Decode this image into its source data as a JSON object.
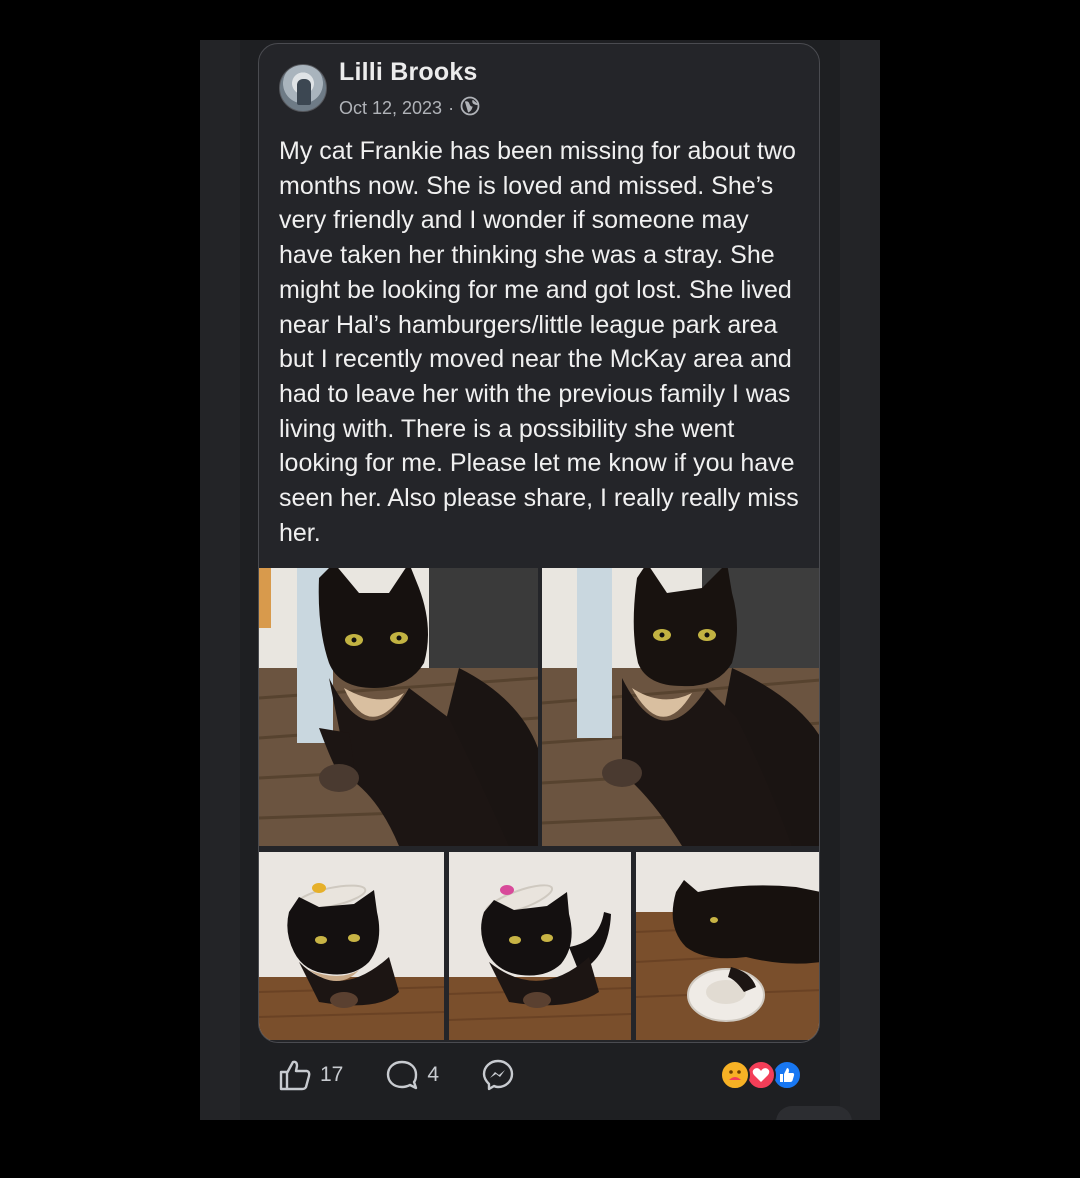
{
  "post": {
    "author": "Lilli Brooks",
    "date": "Oct 12, 2023",
    "separator": "·",
    "privacy_icon": "globe-icon",
    "text": "My cat Frankie has been missing for about two months now. She is loved and missed. She’s very friendly and I wonder if someone may have taken her thinking she was a stray. She might be looking for me and got lost. She lived near Hal’s hamburgers/little league park area but I recently moved near the McKay area and had to leave her with the previous family I was living with. There is a possibility she went looking for me. Please let me know if you have seen her. Also please share, I really really miss her.",
    "photo_count": 5
  },
  "actions": {
    "like_count": "17",
    "comment_count": "4",
    "like_icon": "thumbs-up-icon",
    "comment_icon": "comment-bubble-icon",
    "share_icon": "messenger-icon"
  },
  "reactions": [
    "care-reaction",
    "love-reaction",
    "like-reaction"
  ],
  "colors": {
    "background": "#000000",
    "card": "#242529",
    "text": "#f0f0f0",
    "muted": "#b0b3b8",
    "like_blue": "#1877f2",
    "love_red": "#f33e58",
    "care_yellow": "#f7b125"
  }
}
